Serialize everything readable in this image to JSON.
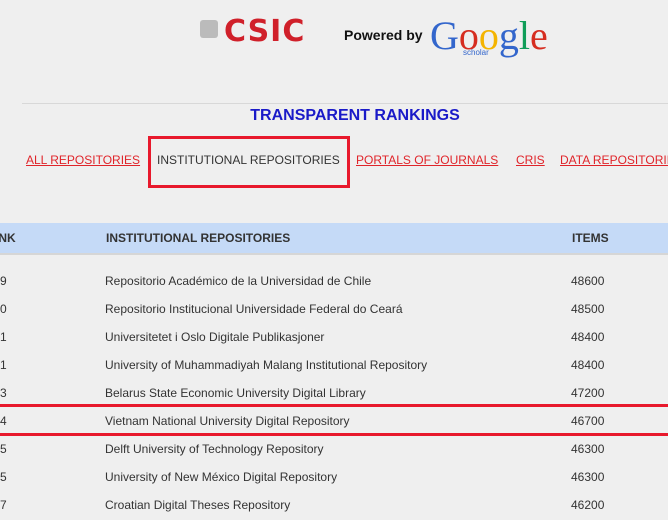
{
  "header": {
    "logo_text": "CSIC",
    "powered_by": "Powered by",
    "google_logo": "Google",
    "google_sub": "scholar"
  },
  "title": "TRANSPARENT RANKINGS",
  "tabs": [
    {
      "label": "ALL REPOSITORIES"
    },
    {
      "label": "INSTITUTIONAL REPOSITORIES",
      "active": true
    },
    {
      "label": "PORTALS OF JOURNALS"
    },
    {
      "label": "CRIS"
    },
    {
      "label": "DATA REPOSITORIES"
    }
  ],
  "table": {
    "headers": {
      "rank": "RANK",
      "name": "INSTITUTIONAL REPOSITORIES",
      "items": "ITEMS"
    },
    "rows": [
      {
        "rank": "9",
        "name": "Repositorio Académico de la Universidad de Chile",
        "items": "48600"
      },
      {
        "rank": "0",
        "name": "Repositorio Institucional Universidade Federal do Ceará",
        "items": "48500"
      },
      {
        "rank": "1",
        "name": "Universitetet i Oslo Digitale Publikasjoner",
        "items": "48400"
      },
      {
        "rank": "1",
        "name": "University of Muhammadiyah Malang Institutional Repository",
        "items": "48400"
      },
      {
        "rank": "3",
        "name": "Belarus State Economic University Digital Library",
        "items": "47200"
      },
      {
        "rank": "4",
        "name": "Vietnam National University Digital Repository",
        "items": "46700",
        "highlighted": true
      },
      {
        "rank": "5",
        "name": "Delft University of Technology Repository",
        "items": "46300"
      },
      {
        "rank": "5",
        "name": "University of New México Digital Repository",
        "items": "46300"
      },
      {
        "rank": "7",
        "name": "Croatian Digital Theses Repository",
        "items": "46200"
      }
    ]
  },
  "colors": {
    "highlight": "#e8192c",
    "link": "#e0242a",
    "title": "#1a1ac8",
    "header_bg": "#c5daf7"
  }
}
